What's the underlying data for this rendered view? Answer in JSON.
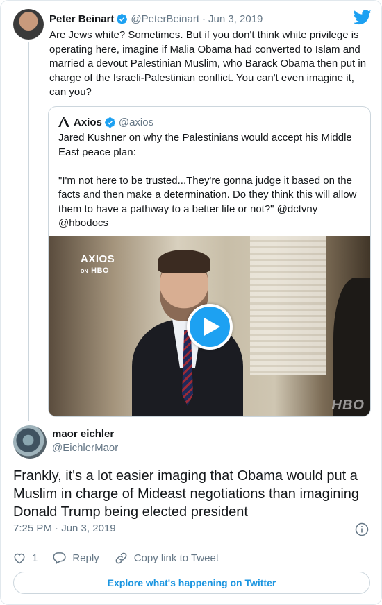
{
  "parent_tweet": {
    "name": "Peter Beinart",
    "handle": "@PeterBeinart",
    "separator": "·",
    "date": "Jun 3, 2019",
    "text": "Are Jews white? Sometimes. But if you don't think white privilege is operating here, imagine if Malia Obama had converted to Islam and married a devout Palestinian Muslim, who Barack Obama then put in charge of the Israeli-Palestinian conflict. You can't even imagine it, can you?"
  },
  "quoted_tweet": {
    "name": "Axios",
    "handle": "@axios",
    "text": "Jared Kushner on why the Palestinians would accept his Middle East peace plan:\n\n\"I'm not here to be trusted...They're gonna judge it based on the facts and then make a determination. Do they think this will allow them to have a pathway to a better life or not?\" @dctvny @hbodocs",
    "video": {
      "watermark_top": "AXIOS",
      "watermark_on": "ON",
      "watermark_hbo": "HBO",
      "watermark_corner": "HBO"
    }
  },
  "reply_tweet": {
    "name": "maor eichler",
    "handle": "@EichlerMaor",
    "text": "Frankly, it's a lot easier imaging that Obama would put a Muslim in charge of Mideast negotiations than imagining Donald Trump being elected president",
    "timestamp": "7:25 PM · Jun 3, 2019"
  },
  "actions": {
    "like_count": "1",
    "reply_label": "Reply",
    "copy_link_label": "Copy link to Tweet"
  },
  "explore_label": "Explore what's happening on Twitter",
  "colors": {
    "twitter_blue": "#1da1f2",
    "link_blue": "#1b95e0",
    "secondary_text": "#657786",
    "border": "#e1e8ed"
  },
  "icons": [
    "twitter-bird-icon",
    "verified-badge-icon",
    "axios-logo-icon",
    "play-icon",
    "info-icon",
    "heart-icon",
    "reply-bubble-icon",
    "link-icon"
  ]
}
